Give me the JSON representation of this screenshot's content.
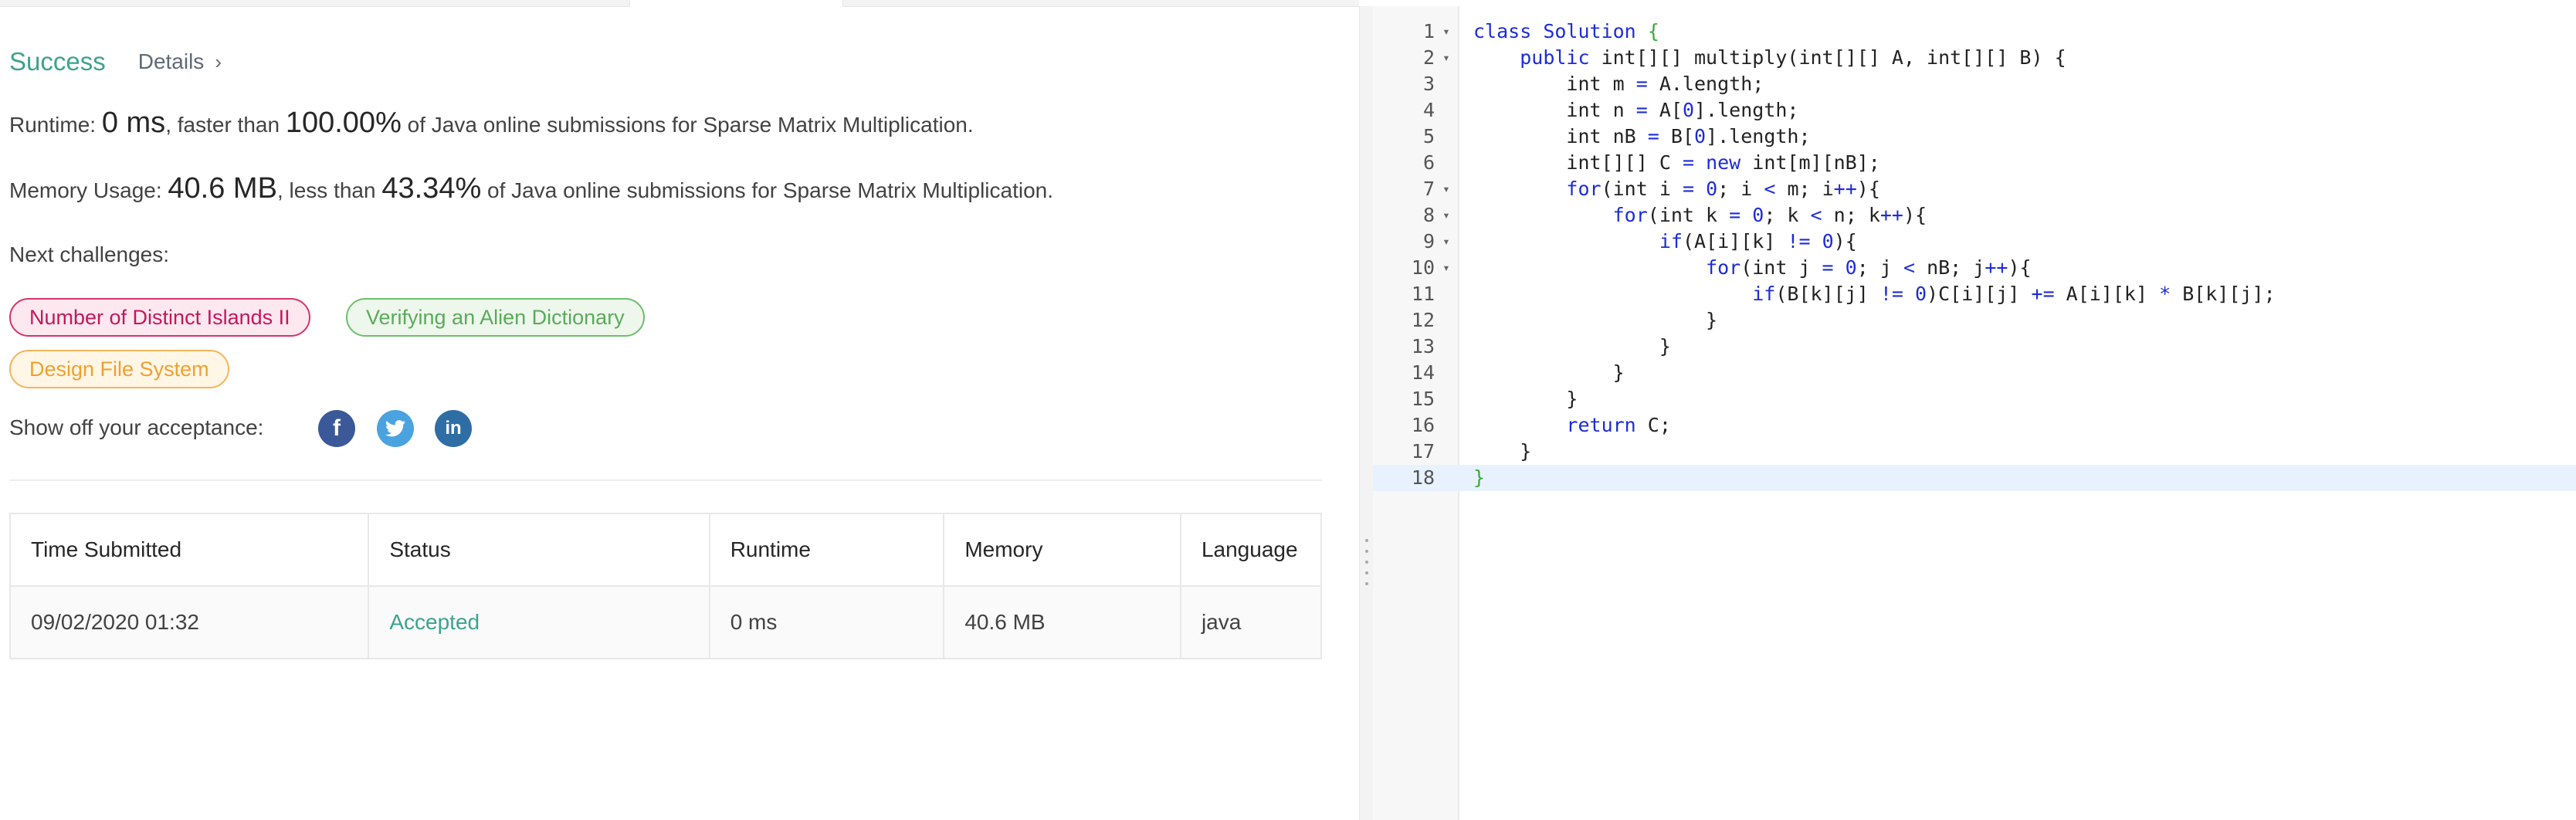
{
  "result": {
    "status": "Success",
    "details_label": "Details",
    "runtime_label": "Runtime:",
    "runtime_value": "0 ms",
    "runtime_mid": ", faster than",
    "runtime_percent": "100.00%",
    "runtime_tail": "of Java online submissions for Sparse Matrix Multiplication.",
    "memory_label": "Memory Usage:",
    "memory_value": "40.6 MB",
    "memory_mid": ", less than",
    "memory_percent": "43.34%",
    "memory_tail": "of Java online submissions for Sparse Matrix Multiplication."
  },
  "challenges": {
    "label": "Next challenges:",
    "items": [
      {
        "label": "Number of Distinct Islands II",
        "difficulty": "hard",
        "color": "#d6336c"
      },
      {
        "label": "Verifying an Alien Dictionary",
        "difficulty": "easy",
        "color": "#6bbf6b"
      },
      {
        "label": "Design File System",
        "difficulty": "medium",
        "color": "#f4b45a"
      }
    ]
  },
  "share": {
    "label": "Show off your acceptance:",
    "icons": [
      "facebook-icon",
      "twitter-icon",
      "linkedin-icon"
    ],
    "fb_glyph": "f",
    "li_glyph": "in"
  },
  "submissions": {
    "headers": [
      "Time Submitted",
      "Status",
      "Runtime",
      "Memory",
      "Language"
    ],
    "rows": [
      [
        "09/02/2020 01:32",
        "Accepted",
        "0 ms",
        "40.6 MB",
        "java"
      ]
    ]
  },
  "editor": {
    "accent": "#1d2cd8",
    "lines": [
      {
        "n": "1",
        "fold": true,
        "text": "class Solution {"
      },
      {
        "n": "2",
        "fold": true,
        "text": "    public int[][] multiply(int[][] A, int[][] B) {"
      },
      {
        "n": "3",
        "fold": false,
        "text": "        int m = A.length;"
      },
      {
        "n": "4",
        "fold": false,
        "text": "        int n = A[0].length;"
      },
      {
        "n": "5",
        "fold": false,
        "text": "        int nB = B[0].length;"
      },
      {
        "n": "6",
        "fold": false,
        "text": "        int[][] C = new int[m][nB];"
      },
      {
        "n": "7",
        "fold": true,
        "text": "        for(int i = 0; i < m; i++){"
      },
      {
        "n": "8",
        "fold": true,
        "text": "            for(int k = 0; k < n; k++){"
      },
      {
        "n": "9",
        "fold": true,
        "text": "                if(A[i][k] != 0){"
      },
      {
        "n": "10",
        "fold": true,
        "text": "                    for(int j = 0; j < nB; j++){"
      },
      {
        "n": "11",
        "fold": false,
        "text": "                        if(B[k][j] != 0)C[i][j] += A[i][k] * B[k][j];"
      },
      {
        "n": "12",
        "fold": false,
        "text": "                    }"
      },
      {
        "n": "13",
        "fold": false,
        "text": "                }"
      },
      {
        "n": "14",
        "fold": false,
        "text": "            }"
      },
      {
        "n": "15",
        "fold": false,
        "text": "        }"
      },
      {
        "n": "16",
        "fold": false,
        "text": "        return C;"
      },
      {
        "n": "17",
        "fold": false,
        "text": "    }"
      },
      {
        "n": "18",
        "fold": false,
        "text": "}",
        "active": true
      }
    ]
  }
}
